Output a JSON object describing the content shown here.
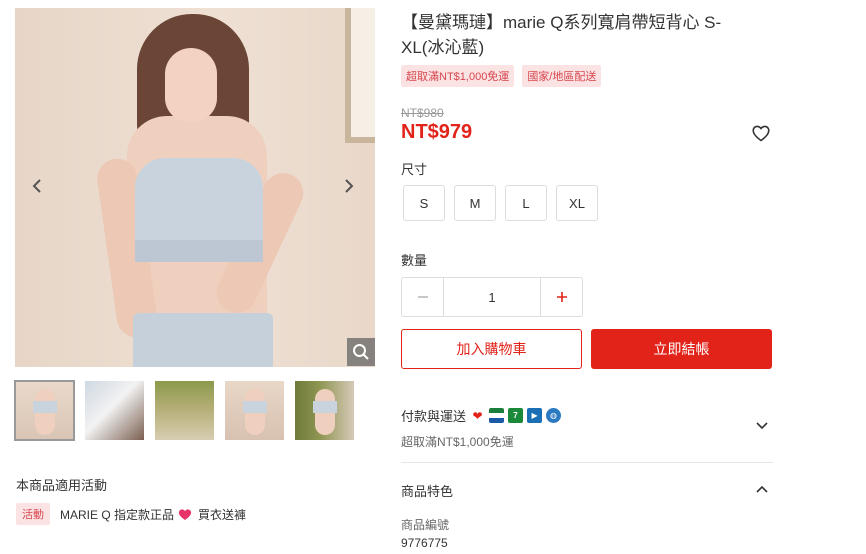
{
  "gallery": {
    "prev_icon": "chevron-left-icon",
    "next_icon": "chevron-right-icon",
    "zoom_icon": "magnifier-icon",
    "thumbnail_count": 5,
    "active_thumbnail": 1
  },
  "promotions": {
    "title": "本商品適用活動",
    "items": [
      {
        "tag": "活動",
        "text": "MARIE Q 指定款正品",
        "icon": "heart-icon",
        "suffix": "買衣送褲"
      }
    ]
  },
  "product": {
    "title": "【曼黛瑪璉】marie Q系列寬肩帶短背心 S-XL(冰沁藍)",
    "badges": [
      "超取滿NT$1,000免運",
      "國家/地區配送"
    ],
    "original_price": "NT$980",
    "price": "NT$979",
    "wishlist_icon": "heart-outline-icon",
    "size_label": "尺寸",
    "sizes": [
      "S",
      "M",
      "L",
      "XL"
    ],
    "quantity_label": "數量",
    "quantity": "1",
    "add_to_cart": "加入購物車",
    "buy_now": "立即結帳"
  },
  "shipping": {
    "title": "付款與運送",
    "icons": [
      "hilife-icon",
      "familymart-icon",
      "7-eleven-icon",
      "ok-mart-icon",
      "globe-icon"
    ],
    "subtitle": "超取滿NT$1,000免運"
  },
  "features": {
    "title": "商品特色",
    "code_label": "商品編號",
    "code_value": "9776775"
  },
  "colors": {
    "accent": "#e2231a",
    "badge_bg": "#fbe3e4",
    "badge_text": "#d6464d"
  }
}
